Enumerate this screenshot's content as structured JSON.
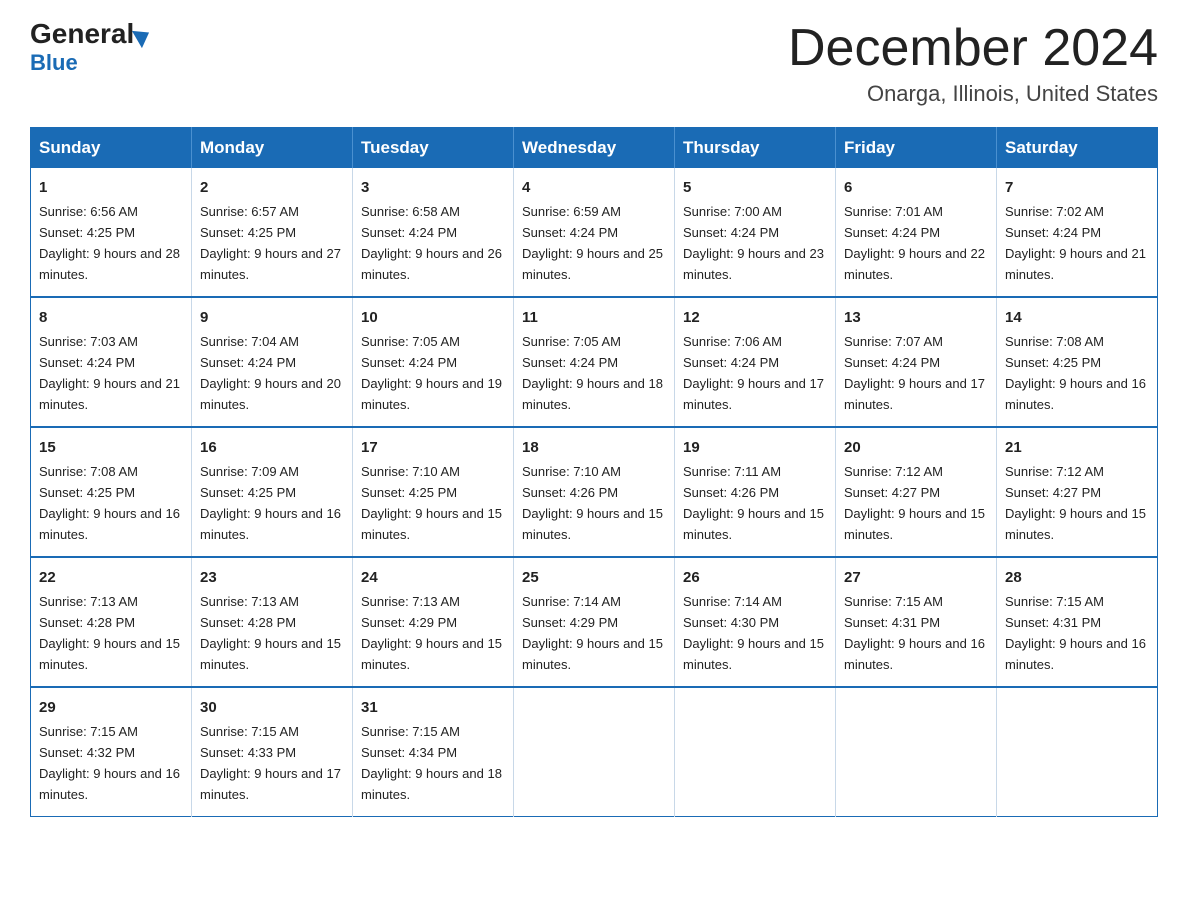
{
  "header": {
    "logo_main": "General",
    "logo_sub": "Blue",
    "month_title": "December 2024",
    "location": "Onarga, Illinois, United States"
  },
  "weekdays": [
    "Sunday",
    "Monday",
    "Tuesday",
    "Wednesday",
    "Thursday",
    "Friday",
    "Saturday"
  ],
  "weeks": [
    [
      {
        "day": "1",
        "sunrise": "6:56 AM",
        "sunset": "4:25 PM",
        "daylight": "9 hours and 28 minutes."
      },
      {
        "day": "2",
        "sunrise": "6:57 AM",
        "sunset": "4:25 PM",
        "daylight": "9 hours and 27 minutes."
      },
      {
        "day": "3",
        "sunrise": "6:58 AM",
        "sunset": "4:24 PM",
        "daylight": "9 hours and 26 minutes."
      },
      {
        "day": "4",
        "sunrise": "6:59 AM",
        "sunset": "4:24 PM",
        "daylight": "9 hours and 25 minutes."
      },
      {
        "day": "5",
        "sunrise": "7:00 AM",
        "sunset": "4:24 PM",
        "daylight": "9 hours and 23 minutes."
      },
      {
        "day": "6",
        "sunrise": "7:01 AM",
        "sunset": "4:24 PM",
        "daylight": "9 hours and 22 minutes."
      },
      {
        "day": "7",
        "sunrise": "7:02 AM",
        "sunset": "4:24 PM",
        "daylight": "9 hours and 21 minutes."
      }
    ],
    [
      {
        "day": "8",
        "sunrise": "7:03 AM",
        "sunset": "4:24 PM",
        "daylight": "9 hours and 21 minutes."
      },
      {
        "day": "9",
        "sunrise": "7:04 AM",
        "sunset": "4:24 PM",
        "daylight": "9 hours and 20 minutes."
      },
      {
        "day": "10",
        "sunrise": "7:05 AM",
        "sunset": "4:24 PM",
        "daylight": "9 hours and 19 minutes."
      },
      {
        "day": "11",
        "sunrise": "7:05 AM",
        "sunset": "4:24 PM",
        "daylight": "9 hours and 18 minutes."
      },
      {
        "day": "12",
        "sunrise": "7:06 AM",
        "sunset": "4:24 PM",
        "daylight": "9 hours and 17 minutes."
      },
      {
        "day": "13",
        "sunrise": "7:07 AM",
        "sunset": "4:24 PM",
        "daylight": "9 hours and 17 minutes."
      },
      {
        "day": "14",
        "sunrise": "7:08 AM",
        "sunset": "4:25 PM",
        "daylight": "9 hours and 16 minutes."
      }
    ],
    [
      {
        "day": "15",
        "sunrise": "7:08 AM",
        "sunset": "4:25 PM",
        "daylight": "9 hours and 16 minutes."
      },
      {
        "day": "16",
        "sunrise": "7:09 AM",
        "sunset": "4:25 PM",
        "daylight": "9 hours and 16 minutes."
      },
      {
        "day": "17",
        "sunrise": "7:10 AM",
        "sunset": "4:25 PM",
        "daylight": "9 hours and 15 minutes."
      },
      {
        "day": "18",
        "sunrise": "7:10 AM",
        "sunset": "4:26 PM",
        "daylight": "9 hours and 15 minutes."
      },
      {
        "day": "19",
        "sunrise": "7:11 AM",
        "sunset": "4:26 PM",
        "daylight": "9 hours and 15 minutes."
      },
      {
        "day": "20",
        "sunrise": "7:12 AM",
        "sunset": "4:27 PM",
        "daylight": "9 hours and 15 minutes."
      },
      {
        "day": "21",
        "sunrise": "7:12 AM",
        "sunset": "4:27 PM",
        "daylight": "9 hours and 15 minutes."
      }
    ],
    [
      {
        "day": "22",
        "sunrise": "7:13 AM",
        "sunset": "4:28 PM",
        "daylight": "9 hours and 15 minutes."
      },
      {
        "day": "23",
        "sunrise": "7:13 AM",
        "sunset": "4:28 PM",
        "daylight": "9 hours and 15 minutes."
      },
      {
        "day": "24",
        "sunrise": "7:13 AM",
        "sunset": "4:29 PM",
        "daylight": "9 hours and 15 minutes."
      },
      {
        "day": "25",
        "sunrise": "7:14 AM",
        "sunset": "4:29 PM",
        "daylight": "9 hours and 15 minutes."
      },
      {
        "day": "26",
        "sunrise": "7:14 AM",
        "sunset": "4:30 PM",
        "daylight": "9 hours and 15 minutes."
      },
      {
        "day": "27",
        "sunrise": "7:15 AM",
        "sunset": "4:31 PM",
        "daylight": "9 hours and 16 minutes."
      },
      {
        "day": "28",
        "sunrise": "7:15 AM",
        "sunset": "4:31 PM",
        "daylight": "9 hours and 16 minutes."
      }
    ],
    [
      {
        "day": "29",
        "sunrise": "7:15 AM",
        "sunset": "4:32 PM",
        "daylight": "9 hours and 16 minutes."
      },
      {
        "day": "30",
        "sunrise": "7:15 AM",
        "sunset": "4:33 PM",
        "daylight": "9 hours and 17 minutes."
      },
      {
        "day": "31",
        "sunrise": "7:15 AM",
        "sunset": "4:34 PM",
        "daylight": "9 hours and 18 minutes."
      },
      null,
      null,
      null,
      null
    ]
  ]
}
